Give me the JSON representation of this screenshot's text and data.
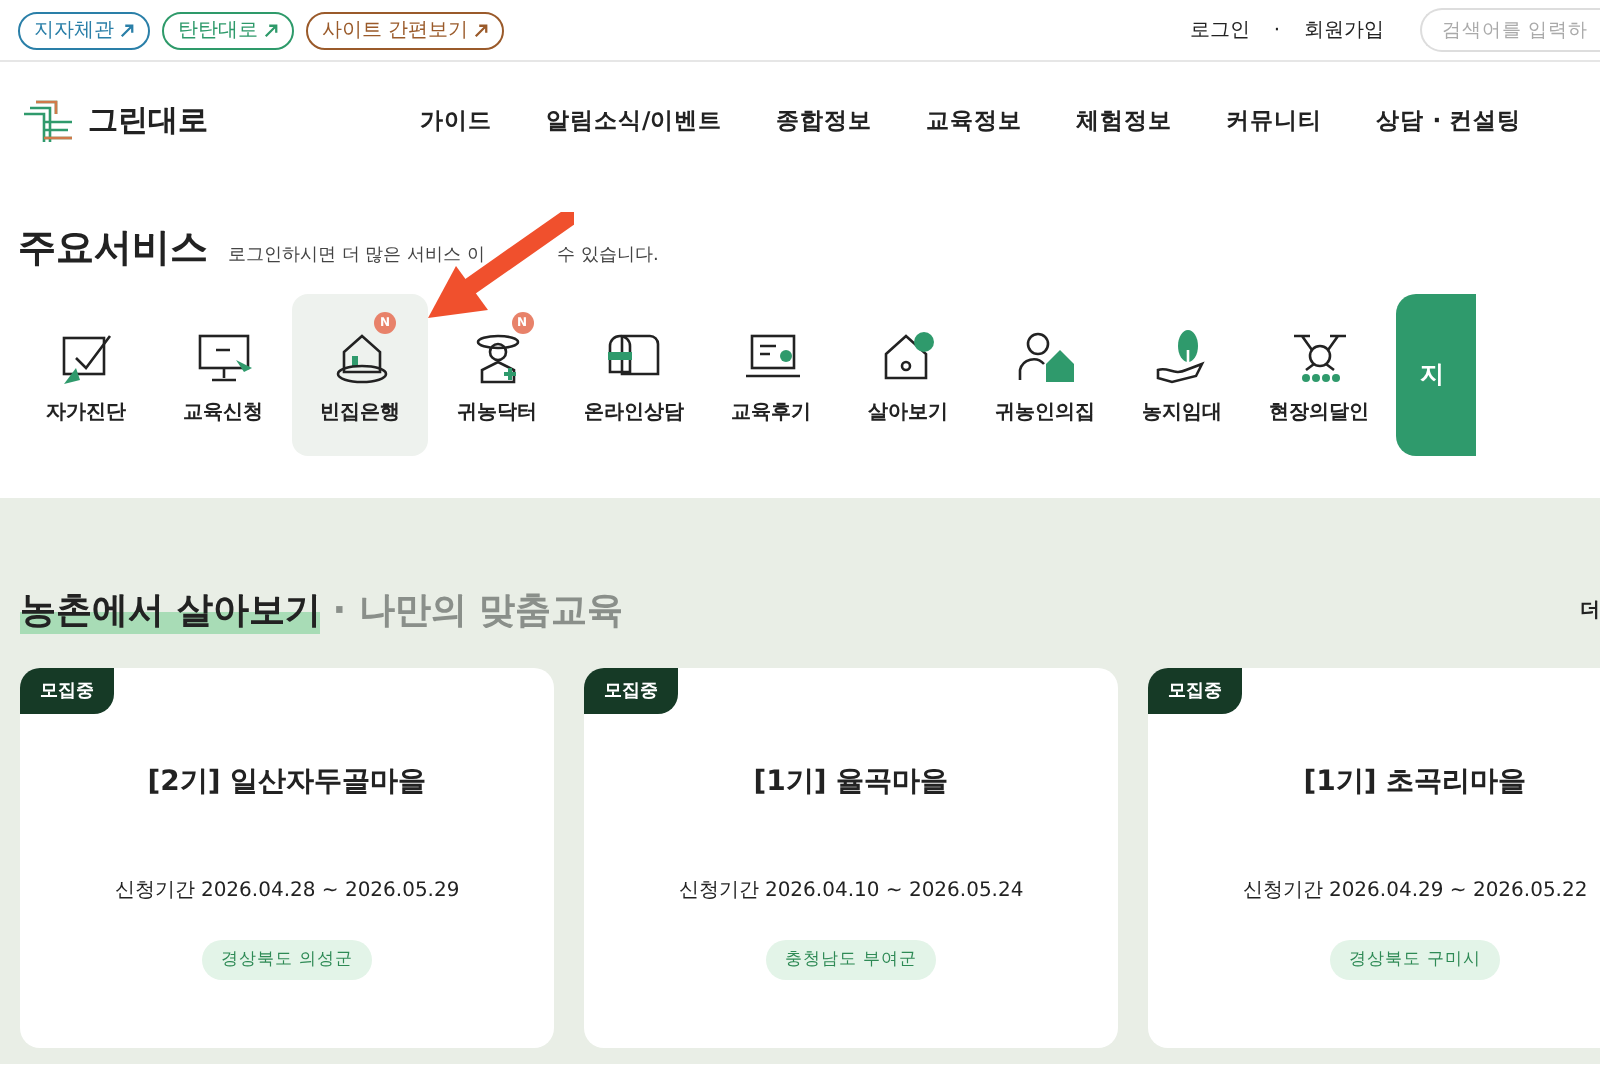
{
  "top_links": [
    {
      "label": "지자체관",
      "color": "#2a7fa8"
    },
    {
      "label": "탄탄대로",
      "color": "#2e9a6a"
    },
    {
      "label": "사이트 간편보기",
      "color": "#9a5a2a"
    }
  ],
  "account": {
    "login": "로그인",
    "separator": "·",
    "signup": "회원가입",
    "search_placeholder": "검색어를 입력하"
  },
  "logo": {
    "text": "그린대로"
  },
  "nav": [
    "가이드",
    "알림소식/이벤트",
    "종합정보",
    "교육정보",
    "체험정보",
    "커뮤니티",
    "상담 · 컨설팅"
  ],
  "services": {
    "title": "주요서비스",
    "note_parts": [
      "로그인하시면 더 많은 서비스",
      "이",
      "수 있습니다."
    ],
    "items": [
      {
        "label": "자가진단",
        "selected": false,
        "new": false
      },
      {
        "label": "교육신청",
        "selected": false,
        "new": false
      },
      {
        "label": "빈집은행",
        "selected": true,
        "new": true,
        "badge": "N"
      },
      {
        "label": "귀농닥터",
        "selected": false,
        "new": true,
        "badge": "N"
      },
      {
        "label": "온라인상담",
        "selected": false,
        "new": false
      },
      {
        "label": "교육후기",
        "selected": false,
        "new": false
      },
      {
        "label": "살아보기",
        "selected": false,
        "new": false
      },
      {
        "label": "귀농인의집",
        "selected": false,
        "new": false
      },
      {
        "label": "농지임대",
        "selected": false,
        "new": false
      },
      {
        "label": "현장의달인",
        "selected": false,
        "new": false
      }
    ],
    "map_button": "지"
  },
  "section": {
    "title": "농촌에서 살아보기",
    "subtitle": "· 나만의 맞춤교육",
    "more": "더",
    "cards": [
      {
        "status": "모집중",
        "title": "[2기] 일산자두골마을",
        "period": "신청기간 2026.04.28 ~ 2026.05.29",
        "region": "경상북도 의성군"
      },
      {
        "status": "모집중",
        "title": "[1기] 율곡마을",
        "period": "신청기간 2026.04.10 ~ 2026.05.24",
        "region": "충청남도 부여군"
      },
      {
        "status": "모집중",
        "title": "[1기] 초곡리마을",
        "period": "신청기간 2026.04.29 ~ 2026.05.22",
        "region": "경상북도 구미시"
      }
    ]
  }
}
